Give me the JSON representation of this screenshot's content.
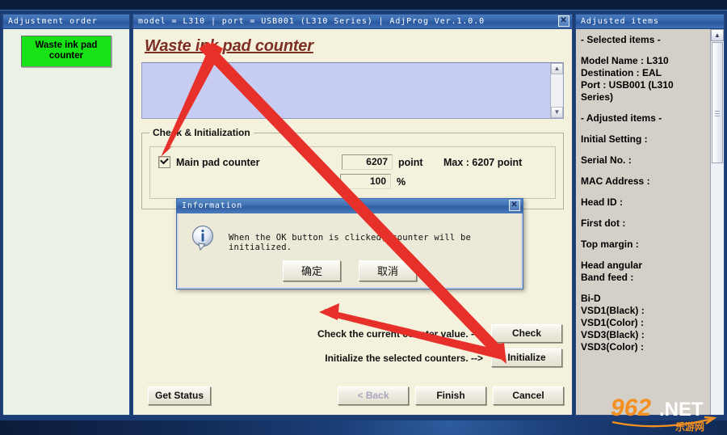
{
  "window": {
    "title": "model = L310 | port = USB001 (L310 Series) | AdjProg Ver.1.0.0",
    "close_label": "✕"
  },
  "sidebar": {
    "title": "Adjustment order",
    "items": [
      {
        "label": "Waste ink pad counter",
        "color": "#16e216"
      }
    ]
  },
  "main": {
    "heading": "Waste ink pad counter",
    "log_text": "",
    "scroll_up": "▲",
    "scroll_down": "▼",
    "group": {
      "legend": "Check & Initialization",
      "counter": {
        "label": "Main pad counter",
        "points_value": "6207",
        "points_unit": "point",
        "max_text": "Max : 6207 point",
        "percent_value": "100",
        "percent_unit": "%"
      }
    },
    "actions": [
      {
        "text": "Check the current counter value. -->",
        "button": "Check"
      },
      {
        "text": "Initialize the selected counters. -->",
        "button": "Initialize"
      }
    ],
    "footer": {
      "get_status": "Get Status",
      "back": "< Back",
      "finish": "Finish",
      "cancel": "Cancel"
    }
  },
  "right": {
    "title": "Adjusted items",
    "entries": [
      "- Selected items -",
      "Model Name : L310\nDestination : EAL\nPort : USB001 (L310 Series)",
      "- Adjusted items -",
      "Initial Setting :",
      "Serial No. :",
      "MAC Address :",
      "Head ID :",
      "First dot :",
      "Top margin :",
      "Head angular\n Band feed :",
      "Bi-D\n VSD1(Black) :\n VSD1(Color) :\n VSD3(Black) :\n VSD3(Color) :"
    ],
    "scroll_up": "▲",
    "scroll_down": "▼"
  },
  "dialog": {
    "title": "Information",
    "close_label": "✕",
    "message": "When the OK button is clicked, counter will be initialized.",
    "ok_label": "确定",
    "cancel_label": "取消"
  },
  "watermark": {
    "number": "962",
    "suffix": ".NET",
    "subtitle": "乐游网"
  },
  "colors": {
    "accent_green": "#16e216",
    "heading_red": "#7d2f24",
    "arrow_red": "#e8302a",
    "titlebar_blue": "#3566ab"
  }
}
